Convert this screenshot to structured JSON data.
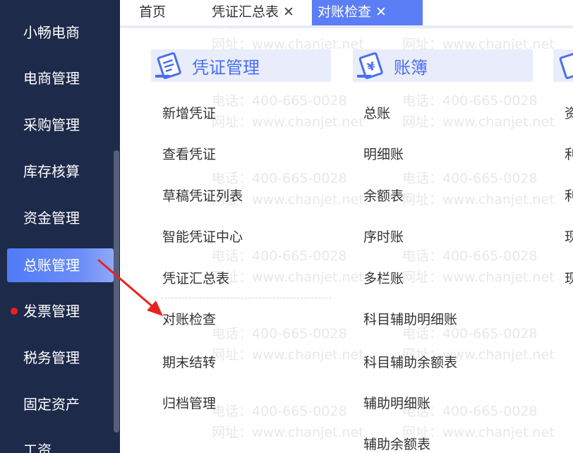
{
  "sidebar": {
    "items": [
      {
        "label": "小畅电商"
      },
      {
        "label": "电商管理"
      },
      {
        "label": "采购管理"
      },
      {
        "label": "库存核算"
      },
      {
        "label": "资金管理"
      },
      {
        "label": "总账管理"
      },
      {
        "label": "发票管理"
      },
      {
        "label": "税务管理"
      },
      {
        "label": "固定资产"
      },
      {
        "label": "工资"
      }
    ],
    "active_index": 5,
    "colors": {
      "background": "#1e2a4a",
      "active": "#5b7ef6",
      "dot": "#f01e1e"
    }
  },
  "tabs": {
    "home": "首页",
    "voucher_summary": "凭证汇总表",
    "reconciliation": "对账检查",
    "close_glyph": "✕"
  },
  "sections": {
    "voucher": {
      "title": "凭证管理",
      "items": [
        "新增凭证",
        "查看凭证",
        "草稿凭证列表",
        "智能凭证中心",
        "凭证汇总表",
        "对账检查",
        "期末结转",
        "归档管理"
      ]
    },
    "ledger": {
      "title": "账簿",
      "items": [
        "总账",
        "明细账",
        "余额表",
        "序时账",
        "多栏账",
        "科目辅助明细账",
        "科目辅助余额表",
        "辅助明细账",
        "辅助余额表"
      ]
    },
    "third": {
      "items": [
        "资",
        "利",
        "利",
        "现",
        "现"
      ]
    }
  },
  "watermark": {
    "phone": "电话：400-665-0028",
    "site": "网址：www.chanjet.net"
  },
  "icons": {
    "voucher": "voucher-document-icon",
    "ledger": "yuan-receipt-icon"
  },
  "accent_color": "#4a6ef0"
}
